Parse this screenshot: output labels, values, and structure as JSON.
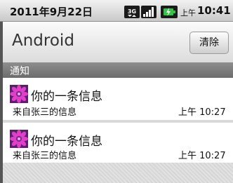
{
  "status_bar": {
    "date": "2011年9月22日",
    "ampm": "上午",
    "time": "10:41",
    "icons": [
      "3g-icon",
      "signal-icon",
      "battery-icon"
    ],
    "icon_3g_text": "3G"
  },
  "header": {
    "title": "Android",
    "clear_label": "清除"
  },
  "section": {
    "label": "通知"
  },
  "notifications": [
    {
      "icon": "flower-icon",
      "title": "你的一条信息",
      "subtitle": "来自张三的信息",
      "time": "上午 10:27"
    },
    {
      "icon": "flower-icon",
      "title": "你的一条信息",
      "subtitle": "来自张三的信息",
      "time": "上午 10:27"
    }
  ],
  "colors": {
    "flower_pink": "#e040c8",
    "flower_purple": "#7a2a8e",
    "battery_green": "#36c247"
  }
}
